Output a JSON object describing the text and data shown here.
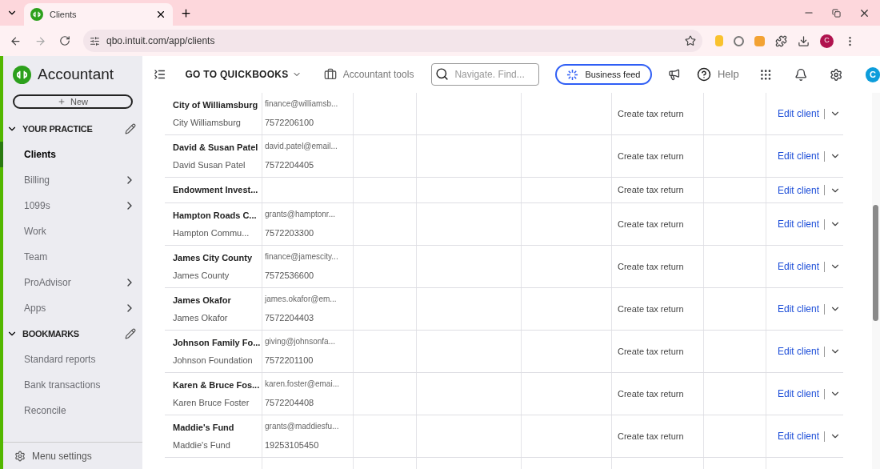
{
  "browser": {
    "tab": {
      "title": "Clients"
    },
    "url": "qbo.intuit.com/app/clients",
    "profile_initial": "C"
  },
  "app": {
    "product": "Accountant",
    "menu": "GO TO QUICKBOOKS",
    "tools": "Accountant tools",
    "search": {
      "placeholder": "Navigate. Find..."
    },
    "feed": "Business feed",
    "help": "Help",
    "avatar": "C"
  },
  "sidebar": {
    "new_button": "New",
    "sections": [
      {
        "title": "YOUR PRACTICE",
        "expanded": true,
        "items": [
          {
            "label": "Clients",
            "selected": true,
            "expandable": false
          },
          {
            "label": "Billing",
            "selected": false,
            "expandable": true
          },
          {
            "label": "1099s",
            "selected": false,
            "expandable": true
          },
          {
            "label": "Work",
            "selected": false,
            "expandable": false
          },
          {
            "label": "Team",
            "selected": false,
            "expandable": false
          },
          {
            "label": "ProAdvisor",
            "selected": false,
            "expandable": true
          },
          {
            "label": "Apps",
            "selected": false,
            "expandable": true
          }
        ]
      },
      {
        "title": "BOOKMARKS",
        "expanded": true,
        "items": [
          {
            "label": "Standard reports",
            "selected": false,
            "expandable": false
          },
          {
            "label": "Bank transactions",
            "selected": false,
            "expandable": false
          },
          {
            "label": "Reconcile",
            "selected": false,
            "expandable": false
          }
        ]
      }
    ],
    "footer": "Menu settings"
  },
  "table": {
    "rows": [
      {
        "name": "City of Williamsburg",
        "contact": "City Williamsburg",
        "email": "finance@williamsb...",
        "phone": "7572206100",
        "action": "Create tax return",
        "edit": "Edit client"
      },
      {
        "name": "David & Susan Patel",
        "contact": "David Susan Patel",
        "email": "david.patel@email...",
        "phone": "7572204405",
        "action": "Create tax return",
        "edit": "Edit client"
      },
      {
        "name": "Endowment Invest...",
        "action": "Create tax return",
        "edit": "Edit client"
      },
      {
        "name": "Hampton Roads C...",
        "contact": "Hampton Commu...",
        "email": "grants@hamptonr...",
        "phone": "7572203300",
        "action": "Create tax return",
        "edit": "Edit client"
      },
      {
        "name": "James City County",
        "contact": "James County",
        "email": "finance@jamescity...",
        "phone": "7572536600",
        "action": "Create tax return",
        "edit": "Edit client"
      },
      {
        "name": "James Okafor",
        "contact": "James Okafor",
        "email": "james.okafor@em...",
        "phone": "7572204403",
        "action": "Create tax return",
        "edit": "Edit client"
      },
      {
        "name": "Johnson Family Fo...",
        "contact": "Johnson Foundation",
        "email": "giving@johnsonfa...",
        "phone": "7572201100",
        "action": "Create tax return",
        "edit": "Edit client"
      },
      {
        "name": "Karen & Bruce Fos...",
        "contact": "Karen Bruce Foster",
        "email": "karen.foster@emai...",
        "phone": "7572204408",
        "action": "Create tax return",
        "edit": "Edit client"
      },
      {
        "name": "Maddie's Fund",
        "contact": "Maddie's Fund",
        "email": "grants@maddiesfu...",
        "phone": "19253105450",
        "action": "Create tax return",
        "edit": "Edit client"
      }
    ]
  }
}
